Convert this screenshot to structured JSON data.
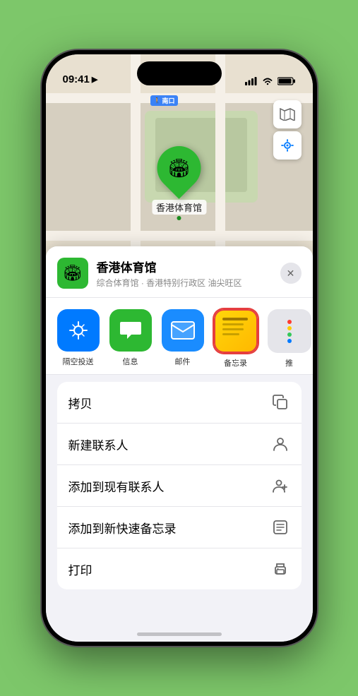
{
  "status": {
    "time": "09:41",
    "location_icon": "▶"
  },
  "map": {
    "label": "南口",
    "pin_label": "香港体育馆",
    "venue_icon": "🏟"
  },
  "sheet": {
    "venue_name": "香港体育馆",
    "venue_sub": "综合体育馆 · 香港特别行政区 油尖旺区",
    "close_label": "✕"
  },
  "share_items": [
    {
      "id": "airdrop",
      "label": "隔空投送",
      "icon": "📡"
    },
    {
      "id": "messages",
      "label": "信息",
      "icon": "💬"
    },
    {
      "id": "mail",
      "label": "邮件",
      "icon": "✉️"
    },
    {
      "id": "notes",
      "label": "备忘录",
      "icon": ""
    },
    {
      "id": "more",
      "label": "推",
      "icon": ""
    }
  ],
  "actions": [
    {
      "label": "拷贝",
      "icon": "copy"
    },
    {
      "label": "新建联系人",
      "icon": "person"
    },
    {
      "label": "添加到现有联系人",
      "icon": "person-add"
    },
    {
      "label": "添加到新快速备忘录",
      "icon": "note"
    },
    {
      "label": "打印",
      "icon": "print"
    }
  ]
}
